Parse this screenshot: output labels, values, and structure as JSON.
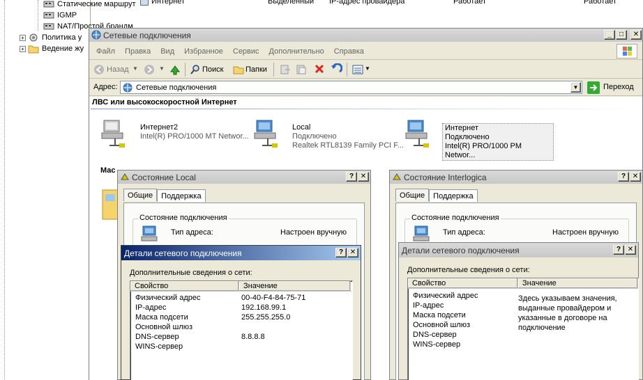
{
  "tree": {
    "items": [
      {
        "label": "Статические маршрут",
        "indent": 2
      },
      {
        "label": "IGMP",
        "indent": 2
      },
      {
        "label": "NAT/Простой брандм",
        "indent": 2
      },
      {
        "label": "Политика у",
        "indent": 0
      },
      {
        "label": "Ведение жу",
        "indent": 0
      }
    ]
  },
  "bg_list": {
    "row": [
      "Интернет",
      "Выделенный",
      "IP-адрес провайдера",
      "Работает",
      "Работает"
    ]
  },
  "explorer": {
    "title": "Сетевые подключения",
    "menu": [
      "Файл",
      "Правка",
      "Вид",
      "Избранное",
      "Сервис",
      "Дополнительно",
      "Справка"
    ],
    "toolbar": {
      "back": "Назад",
      "search": "Поиск",
      "folders": "Папки"
    },
    "address_label": "Адрес:",
    "address_value": "Сетевые подключения",
    "go_label": "Переход",
    "group_heading": "ЛВС или высокоскоростной Интернет",
    "second_group_heading": "Мас",
    "connections": [
      {
        "name": "Интернет2",
        "status": "",
        "device": "Intel(R) PRO/1000 MT Networ..."
      },
      {
        "name": "Local",
        "status": "Подключено",
        "device": "Realtek RTL8139 Family PCI F..."
      },
      {
        "name": "Интернет",
        "status": "Подключено",
        "device": "Intel(R) PRO/1000 PM Networ..."
      }
    ]
  },
  "status_local": {
    "title": "Состояние Local",
    "tabs": [
      "Общие",
      "Поддержка"
    ],
    "group": "Состояние подключения",
    "addr_type_label": "Тип адреса:",
    "addr_type_value": "Настроен вручную"
  },
  "status_interlogica": {
    "title": "Состояние Interlogica",
    "tabs": [
      "Общие",
      "Поддержка"
    ],
    "group": "Состояние подключения",
    "addr_type_label": "Тип адреса:",
    "addr_type_value": "Настроен вручную"
  },
  "details_left": {
    "title": "Детали сетевого подключения",
    "intro": "Дополнительные сведения о сети:",
    "col_property": "Свойство",
    "col_value": "Значение",
    "rows": [
      {
        "prop": "Физический адрес",
        "val": "00-40-F4-84-75-71"
      },
      {
        "prop": "IP-адрес",
        "val": "192.168.99.1"
      },
      {
        "prop": "Маска подсети",
        "val": "255.255.255.0"
      },
      {
        "prop": "Основной шлюз",
        "val": ""
      },
      {
        "prop": "DNS-сервер",
        "val": "8.8.8.8"
      },
      {
        "prop": "WINS-сервер",
        "val": ""
      }
    ]
  },
  "details_right": {
    "title": "Детали сетевого подключения",
    "intro": "Дополнительные сведения о сети:",
    "col_property": "Свойство",
    "col_value": "Значение",
    "props": [
      "Физический адрес",
      "IP-адрес",
      "Маска подсети",
      "Основной шлюз",
      "DNS-сервер",
      "WINS-сервер"
    ],
    "note": [
      "Здесь указываем значения,",
      "выданные провайдером и",
      "указанные в договоре на",
      "подключение"
    ]
  },
  "colors": {
    "title_active": "#0a246a",
    "window_face": "#ece9d8",
    "link": "#0046d5"
  }
}
